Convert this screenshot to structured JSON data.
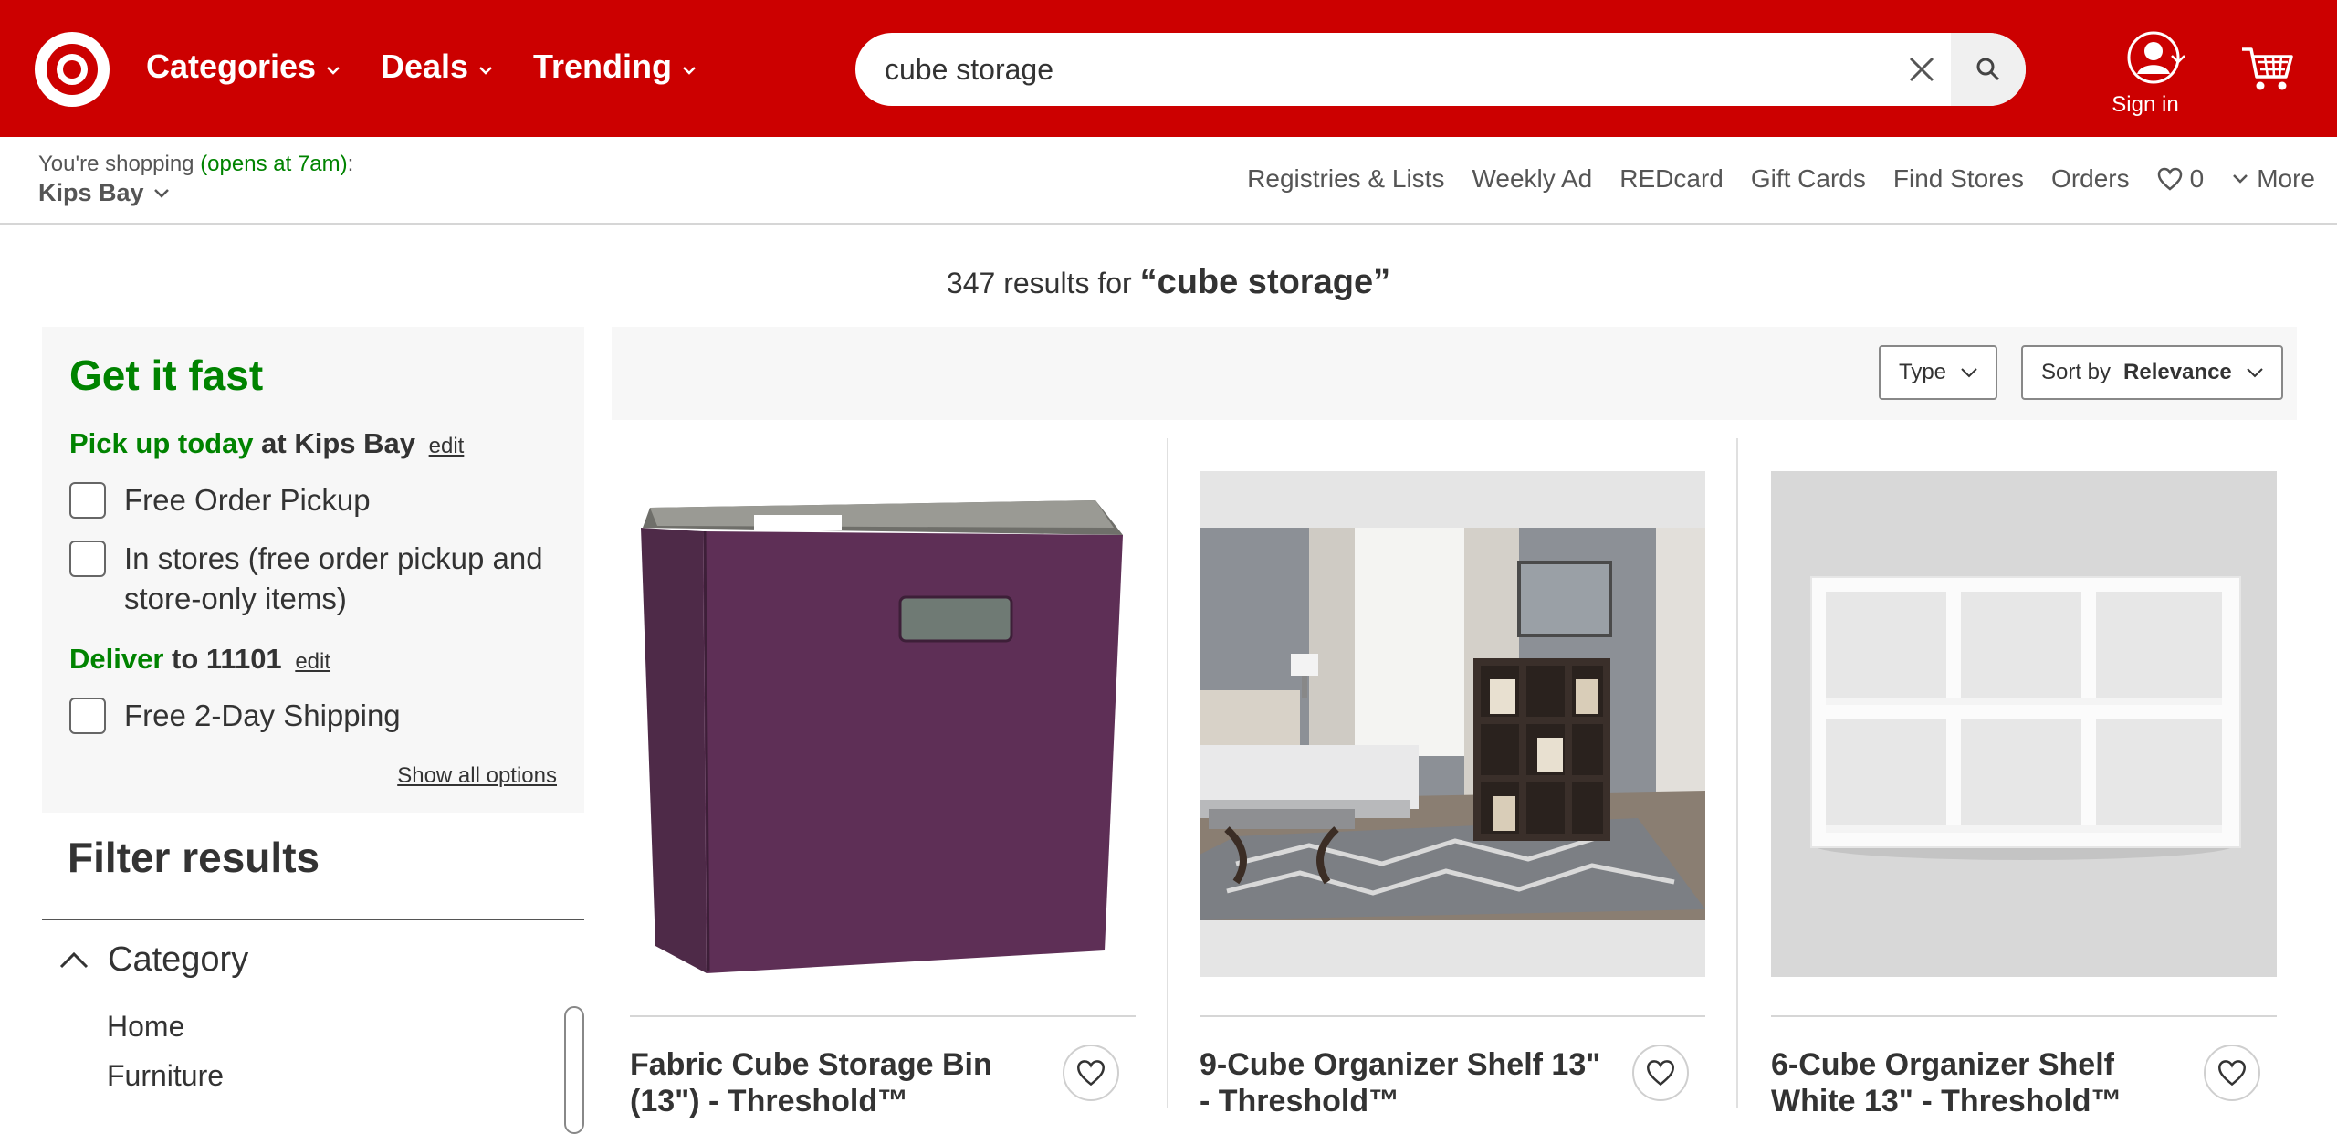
{
  "header": {
    "nav": [
      {
        "label": "Categories"
      },
      {
        "label": "Deals"
      },
      {
        "label": "Trending"
      }
    ],
    "search": {
      "value": "cube storage",
      "placeholder": "Search"
    },
    "account_label": "Sign in"
  },
  "subheader": {
    "shopping_prefix": "You're shopping ",
    "opens": "(opens at 7am)",
    "colon": ":",
    "store": "Kips Bay",
    "links": [
      "Registries & Lists",
      "Weekly Ad",
      "REDcard",
      "Gift Cards",
      "Find Stores",
      "Orders"
    ],
    "favorites_count": "0",
    "more": "More"
  },
  "results": {
    "count_text": "347 results for ",
    "query": "“cube storage”"
  },
  "fast": {
    "title": "Get it fast",
    "pickup_green": "Pick up today",
    "pickup_rest": " at Kips Bay",
    "edit": "edit",
    "pickup_options": [
      "Free Order Pickup",
      "In stores (free order pickup and store-only items)"
    ],
    "deliver_green": "Deliver",
    "deliver_rest": " to 11101",
    "ship_option": "Free 2-Day Shipping",
    "show_all": "Show all options"
  },
  "filter": {
    "title": "Filter results",
    "category_label": "Category",
    "items": [
      "Home",
      "Furniture"
    ]
  },
  "toolbar": {
    "type_label": "Type",
    "sort_prefix": "Sort by",
    "sort_value": "Relevance"
  },
  "products": [
    {
      "title": "Fabric Cube Storage Bin (13\") - Threshold™"
    },
    {
      "title": "9-Cube Organizer Shelf 13\" - Threshold™"
    },
    {
      "title": "6-Cube Organizer Shelf White 13\" - Threshold™"
    }
  ],
  "colors": {
    "brand": "#cc0000",
    "green": "#008300",
    "text": "#333333"
  }
}
